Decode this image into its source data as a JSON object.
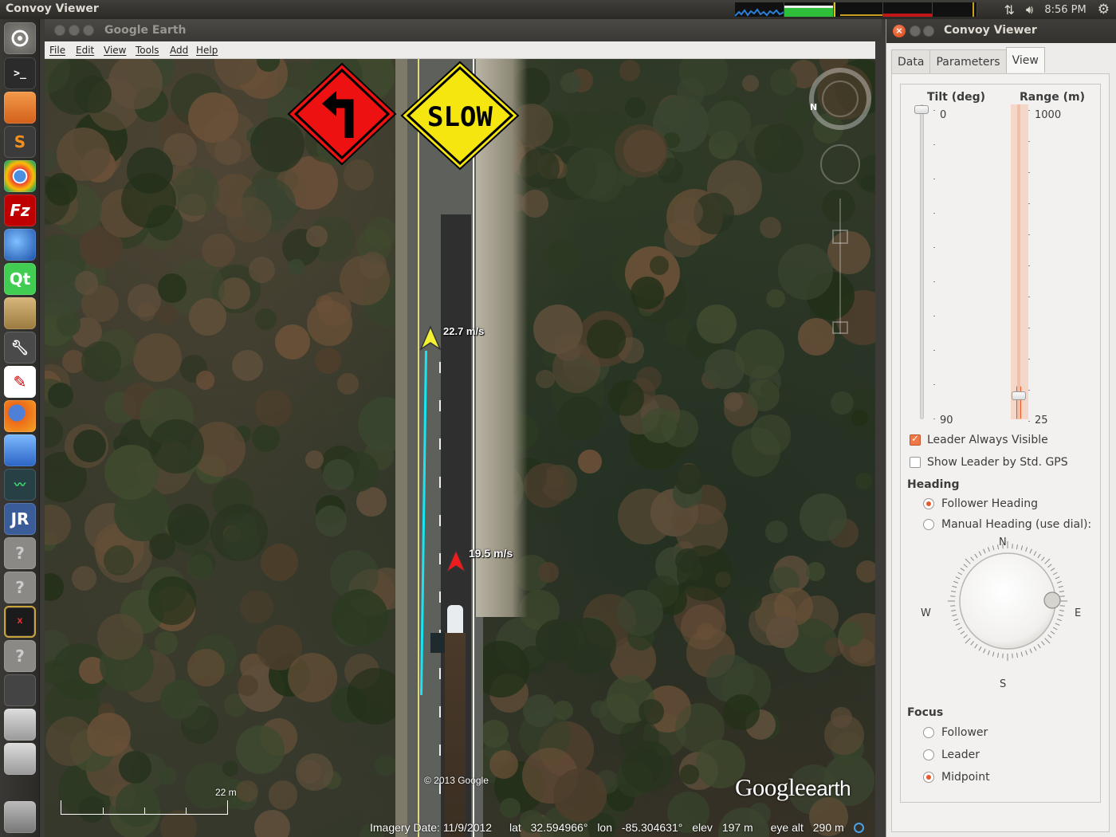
{
  "top_panel": {
    "title": "Convoy Viewer",
    "time": "8:56 PM"
  },
  "google_earth": {
    "title": "Google Earth",
    "menu": [
      "File",
      "Edit",
      "View",
      "Tools",
      "Add",
      "Help"
    ],
    "signs": {
      "turn_sign_color": "#ee1111",
      "slow_sign_text": "SLOW",
      "slow_sign_color": "#f5e60f"
    },
    "leader_speed": "22.7 m/s",
    "follower_speed": "19.5 m/s",
    "scale_text": "22 m",
    "copyright": "© 2013 Google",
    "logo_google": "Google",
    "logo_earth": "earth",
    "status": {
      "imagery_date": "Imagery Date: 11/9/2012",
      "lat_label": "lat",
      "lat": "32.594966°",
      "lon_label": "lon",
      "lon": "-85.304631°",
      "elev_label": "elev",
      "elev": "197 m",
      "eye_alt_label": "eye alt",
      "eye_alt": "290 m"
    }
  },
  "convoy_viewer": {
    "title": "Convoy Viewer",
    "tabs": [
      "Data",
      "Parameters",
      "View"
    ],
    "active_tab": "View",
    "tilt": {
      "label": "Tilt (deg)",
      "min": "0",
      "max": "90",
      "value": 0
    },
    "range": {
      "label": "Range (m)",
      "top": "1000",
      "bottom": "25",
      "value": 25
    },
    "leader_always_visible": {
      "label": "Leader Always Visible",
      "checked": true
    },
    "show_leader_gps": {
      "label": "Show Leader by Std. GPS",
      "checked": false
    },
    "heading": {
      "title": "Heading",
      "follower": "Follower Heading",
      "manual": "Manual Heading (use dial):",
      "selected": "follower",
      "dial": {
        "n": "N",
        "e": "E",
        "s": "S",
        "w": "W"
      }
    },
    "focus": {
      "title": "Focus",
      "options": [
        "Follower",
        "Leader",
        "Midpoint"
      ],
      "selected": "Midpoint"
    },
    "accent_color": "#f07746"
  }
}
